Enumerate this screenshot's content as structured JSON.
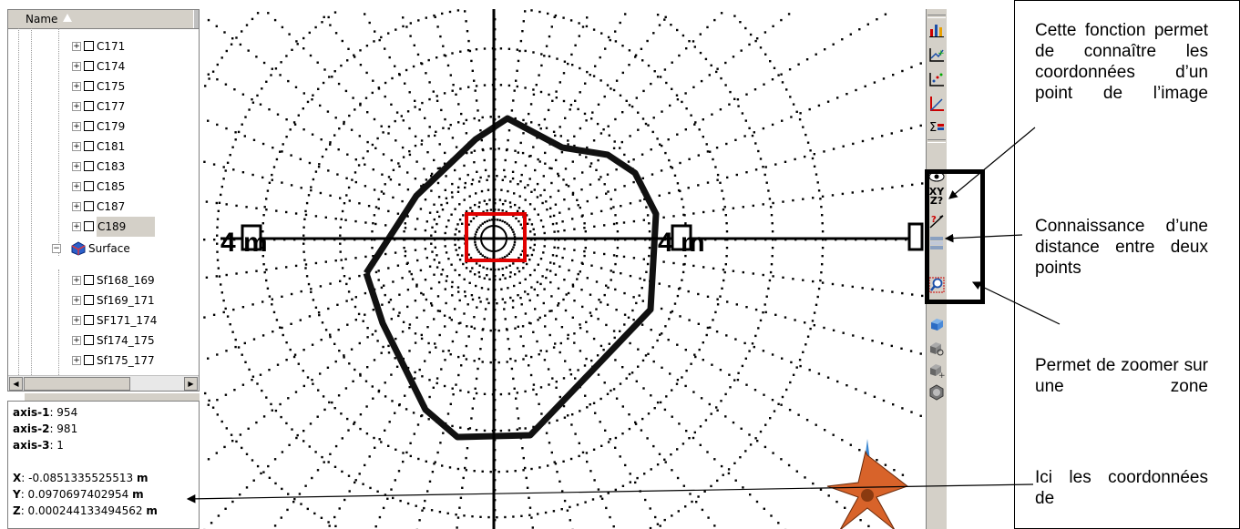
{
  "tree": {
    "header": "Name",
    "items": [
      {
        "label": "C171",
        "kind": "point"
      },
      {
        "label": "C174",
        "kind": "point"
      },
      {
        "label": "C175",
        "kind": "point"
      },
      {
        "label": "C177",
        "kind": "point"
      },
      {
        "label": "C179",
        "kind": "point"
      },
      {
        "label": "C181",
        "kind": "point"
      },
      {
        "label": "C183",
        "kind": "point"
      },
      {
        "label": "C185",
        "kind": "point"
      },
      {
        "label": "C187",
        "kind": "point"
      },
      {
        "label": "C189",
        "kind": "point",
        "selected": true
      },
      {
        "label": "Surface",
        "kind": "group"
      },
      {
        "label": "Sf168_169",
        "kind": "surface"
      },
      {
        "label": "Sf169_171",
        "kind": "surface"
      },
      {
        "label": "SF171_174",
        "kind": "surface"
      },
      {
        "label": "Sf174_175",
        "kind": "surface"
      },
      {
        "label": "Sf175_177",
        "kind": "surface"
      }
    ]
  },
  "info": {
    "axis1_label": "axis-1",
    "axis1_value": ": 954",
    "axis2_label": "axis-2",
    "axis2_value": ": 981",
    "axis3_label": "axis-3",
    "axis3_value": ": 1",
    "x_label": "X",
    "x_value": ": -0.0851335525513 ",
    "x_unit": "m",
    "y_label": "Y",
    "y_value": ": 0.0970697402954 ",
    "y_unit": "m",
    "z_label": "Z",
    "z_value": ": 0.000244133494562 ",
    "z_unit": "m"
  },
  "image": {
    "scale_label": "4 m"
  },
  "toolbar": {
    "icons": [
      "histogram-icon",
      "chart-add-icon",
      "scatter-icon",
      "axis-plot-icon",
      "sigma-chart-icon",
      "pick-coordinates-icon",
      "measure-distance-icon",
      "list-icon",
      "zoom-zone-icon",
      "cube-icon",
      "select-object-icon",
      "add-object-icon",
      "sphere-object-icon"
    ],
    "coords_label": "XY Z?"
  },
  "annotations": [
    "Cette fonction permet de connaître les coordonnées d’un point de l’image",
    "Connaissance d’une distance entre deux points",
    "Permet de zoomer sur une zone",
    "Ici les coordonnées de"
  ],
  "colors": {
    "red_box": "#e00000",
    "highlight": "#000000",
    "toolbar_bg": "#d4d0c8"
  }
}
